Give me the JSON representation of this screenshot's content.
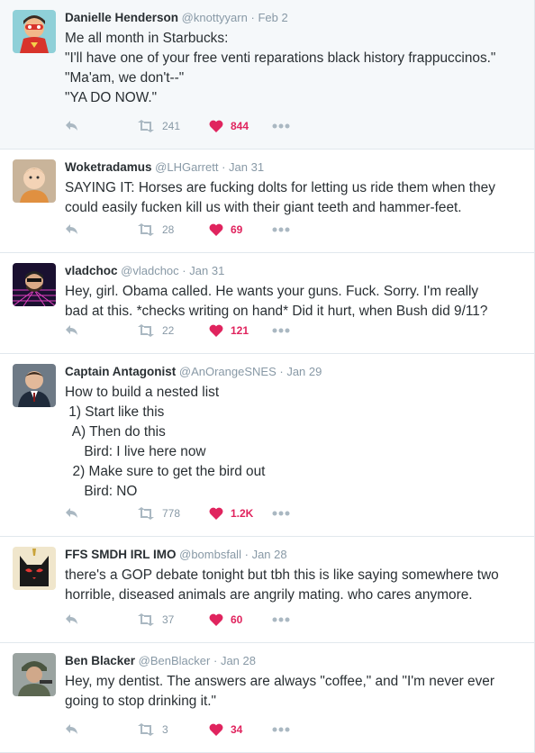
{
  "colors": {
    "like_active": "#e0245e",
    "meta_gray": "#8899a6",
    "text": "#292f33",
    "highlight_bg": "#f5f8fa"
  },
  "tweets": [
    {
      "fullname": "Danielle Henderson",
      "username": "@knottyyarn",
      "time": "Feb 2",
      "lines": [
        "Me all month in Starbucks:",
        "\"I'll have one of your free venti reparations black history frappuccinos.\"",
        "\"Ma'am, we don't--\"",
        "\"YA DO NOW.\""
      ],
      "retweets": "241",
      "likes": "844",
      "avatar_icon": "superhero-cartoon-avatar"
    },
    {
      "fullname": "Woketradamus",
      "username": "@LHGarrett",
      "time": "Jan 31",
      "lines": [
        "SAYING IT: Horses are fucking dolts for letting us ride them when they",
        "could easily fucken kill us with their giant teeth and hammer-feet."
      ],
      "retweets": "28",
      "likes": "69",
      "avatar_icon": "child-photo-avatar"
    },
    {
      "fullname": "vladchoc",
      "username": "@vladchoc",
      "time": "Jan 31",
      "lines": [
        "Hey, girl. Obama called. He wants your guns. Fuck. Sorry. I'm really",
        "bad at this. *checks writing on hand* Did it hurt, when Bush did 9/11?"
      ],
      "retweets": "22",
      "likes": "121",
      "avatar_icon": "neon-grid-avatar"
    },
    {
      "fullname": "Captain Antagonist",
      "username": "@AnOrangeSNES",
      "time": "Jan 29",
      "lines": [
        "How to build a nested list",
        " 1) Start like this",
        "  A) Then do this",
        "     Bird: I live here now",
        "  2) Make sure to get the bird out",
        "     Bird: NO"
      ],
      "retweets": "778",
      "likes": "1.2K",
      "avatar_icon": "man-in-suit-avatar"
    },
    {
      "fullname": "FFS SMDH IRL IMO",
      "username": "@bombsfall",
      "time": "Jan 28",
      "lines": [
        "there's a GOP debate tonight but tbh this is like saying somewhere two",
        "horrible, diseased animals are angrily mating. who cares anymore."
      ],
      "retweets": "37",
      "likes": "60",
      "avatar_icon": "black-cat-avatar"
    },
    {
      "fullname": "Ben Blacker",
      "username": "@BenBlacker",
      "time": "Jan 28",
      "lines": [
        "Hey, my dentist. The answers are always \"coffee,\" and \"I'm never ever",
        "going to stop drinking it.\""
      ],
      "retweets": "3",
      "likes": "34",
      "avatar_icon": "soldier-photo-avatar"
    }
  ]
}
